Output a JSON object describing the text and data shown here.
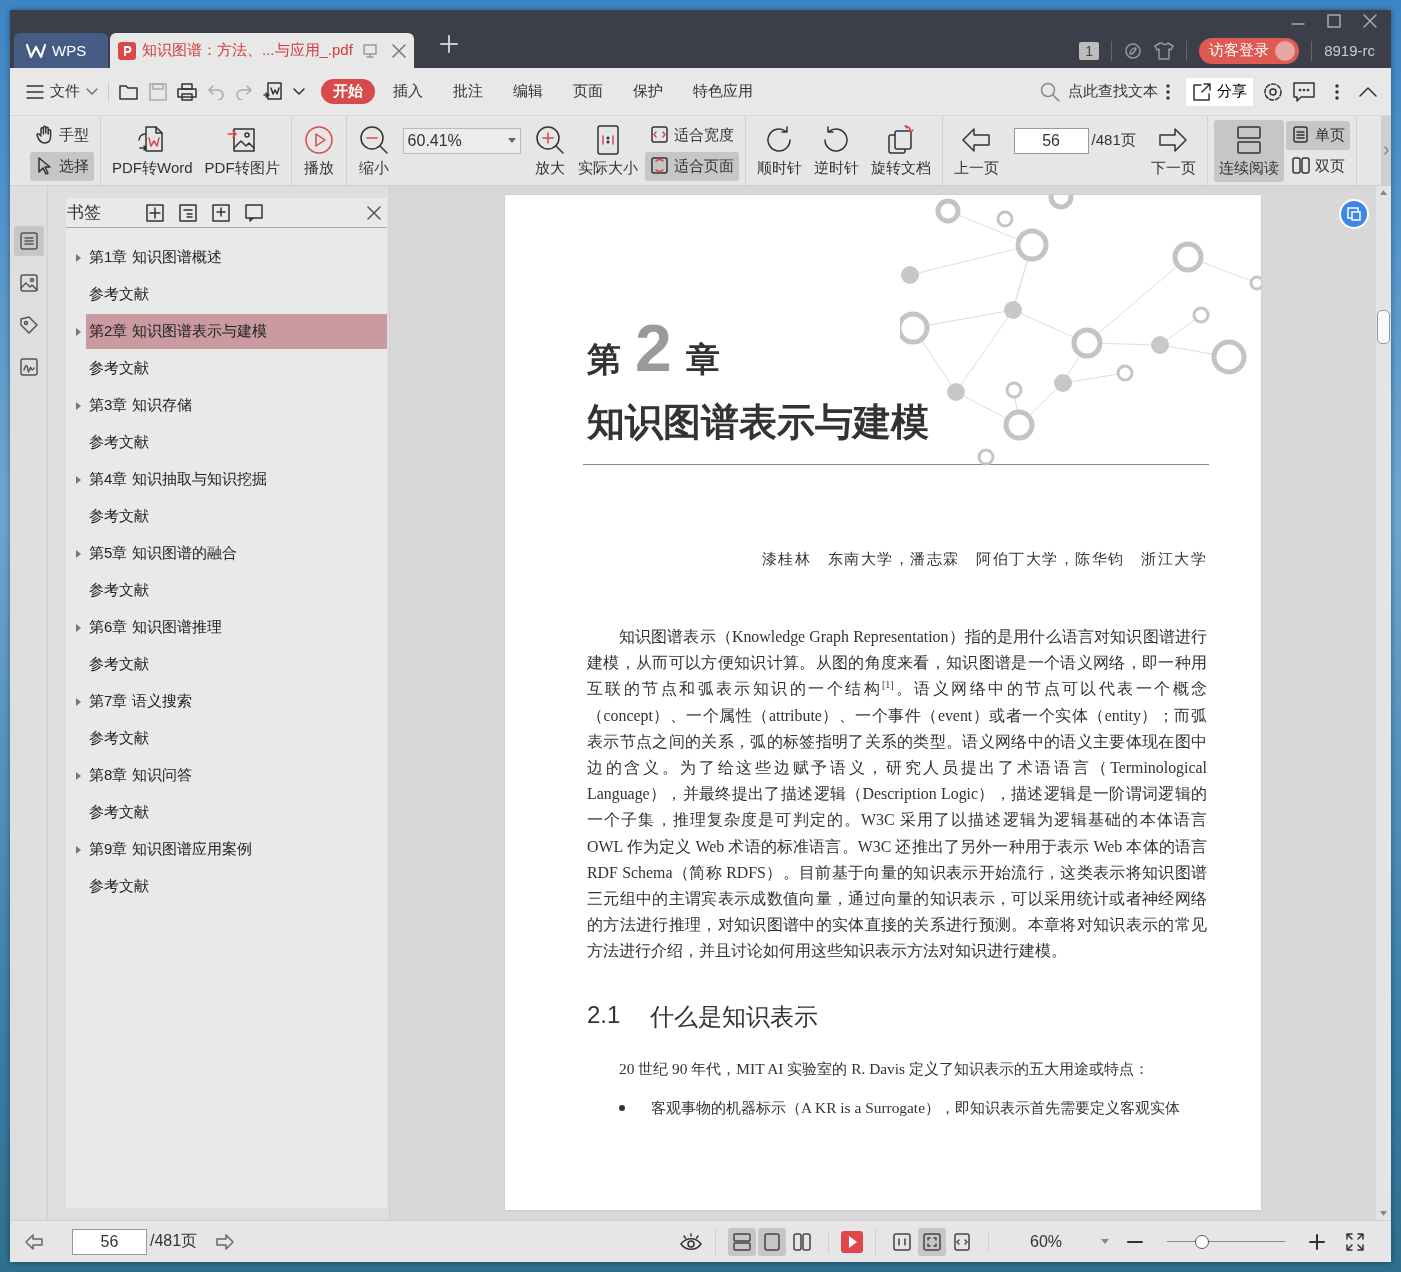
{
  "tabs": [
    {
      "kind": "home",
      "label": "WPS",
      "selected": false
    },
    {
      "kind": "document",
      "label": "知识图谱：方法、...与应用_.pdf",
      "selected": true
    }
  ],
  "account": {
    "badge": "1",
    "login": "访客登录",
    "user": "8919-rc"
  },
  "menu": {
    "file": "文件",
    "tabs": [
      {
        "label": "开始",
        "selected": true
      },
      {
        "label": "插入",
        "selected": false
      },
      {
        "label": "批注",
        "selected": false
      },
      {
        "label": "编辑",
        "selected": false
      },
      {
        "label": "页面",
        "selected": false
      },
      {
        "label": "保护",
        "selected": false
      },
      {
        "label": "特色应用",
        "selected": false
      }
    ],
    "search_placeholder": "点此查找文本",
    "share": "分享"
  },
  "toolbar": {
    "groups": [
      [
        {
          "kind": "pair",
          "items": [
            {
              "label": "手型",
              "selected": false
            },
            {
              "label": "选择",
              "selected": true
            }
          ]
        }
      ],
      [
        {
          "kind": "big",
          "label": "PDF转Word",
          "selected": false
        },
        {
          "kind": "big",
          "label": "PDF转图片",
          "selected": false
        }
      ],
      [
        {
          "kind": "big",
          "label": "播放",
          "selected": false
        }
      ],
      [
        {
          "kind": "big",
          "label": "缩小",
          "selected": false
        },
        {
          "kind": "zoom",
          "value": "60.41%"
        },
        {
          "kind": "big",
          "label": "放大",
          "selected": false
        },
        {
          "kind": "big",
          "label": "实际大小",
          "selected": false
        },
        {
          "kind": "pair",
          "items": [
            {
              "label": "适合宽度",
              "selected": false
            },
            {
              "label": "适合页面",
              "selected": true
            }
          ]
        }
      ],
      [
        {
          "kind": "big",
          "label": "顺时针",
          "selected": false
        },
        {
          "kind": "big",
          "label": "逆时针",
          "selected": false
        },
        {
          "kind": "big",
          "label": "旋转文档",
          "selected": false
        }
      ],
      [
        {
          "kind": "big",
          "label": "上一页",
          "selected": false
        },
        {
          "kind": "page",
          "value": "56",
          "total": "/481页"
        },
        {
          "kind": "big",
          "label": "下一页",
          "selected": false
        }
      ],
      [
        {
          "kind": "big",
          "label": "连续阅读",
          "selected": true
        },
        {
          "kind": "pair",
          "items": [
            {
              "label": "单页",
              "selected": true
            },
            {
              "label": "双页",
              "selected": false
            }
          ]
        }
      ]
    ]
  },
  "rail": [
    {
      "selected": true
    },
    {
      "selected": false
    },
    {
      "selected": false
    },
    {
      "selected": false
    }
  ],
  "sidebar": {
    "title": "书签",
    "items": [
      {
        "kind": "chapter",
        "label": "第1章 知识图谱概述",
        "expanded": false,
        "selected": false
      },
      {
        "kind": "reference",
        "label": "参考文献",
        "selected": false
      },
      {
        "kind": "chapter",
        "label": "第2章 知识图谱表示与建模",
        "expanded": false,
        "selected": true
      },
      {
        "kind": "reference",
        "label": "参考文献",
        "selected": false
      },
      {
        "kind": "chapter",
        "label": "第3章 知识存储",
        "expanded": false,
        "selected": false
      },
      {
        "kind": "reference",
        "label": "参考文献",
        "selected": false
      },
      {
        "kind": "chapter",
        "label": "第4章 知识抽取与知识挖掘",
        "expanded": false,
        "selected": false
      },
      {
        "kind": "reference",
        "label": "参考文献",
        "selected": false
      },
      {
        "kind": "chapter",
        "label": "第5章 知识图谱的融合",
        "expanded": false,
        "selected": false
      },
      {
        "kind": "reference",
        "label": "参考文献",
        "selected": false
      },
      {
        "kind": "chapter",
        "label": "第6章 知识图谱推理",
        "expanded": false,
        "selected": false
      },
      {
        "kind": "reference",
        "label": "参考文献",
        "selected": false
      },
      {
        "kind": "chapter",
        "label": "第7章 语义搜索",
        "expanded": false,
        "selected": false
      },
      {
        "kind": "reference",
        "label": "参考文献",
        "selected": false
      },
      {
        "kind": "chapter",
        "label": "第8章 知识问答",
        "expanded": false,
        "selected": false
      },
      {
        "kind": "reference",
        "label": "参考文献",
        "selected": false
      },
      {
        "kind": "chapter",
        "label": "第9章 知识图谱应用案例",
        "expanded": false,
        "selected": false
      },
      {
        "kind": "reference",
        "label": "参考文献",
        "selected": false
      }
    ]
  },
  "document": {
    "chapter_prefix": "第",
    "chapter_number": "2",
    "chapter_suffix": "章",
    "title": "知识图谱表示与建模",
    "authors": "漆桂林　东南大学，潘志霖　阿伯丁大学，陈华钧　浙江大学",
    "intro": "知识图谱表示（Knowledge Graph Representation）指的是用什么语言对知识图谱进行建模，从而可以方便知识计算。从图的角度来看，知识图谱是一个语义网络，即一种用互联的节点和弧表示知识的一个结构$^{[1]}$。语义网络中的节点可以代表一个概念（concept）、一个属性（attribute）、一个事件（event）或者一个实体（entity）；而弧表示节点之间的关系，弧的标签指明了关系的类型。语义网络中的语义主要体现在图中边的含义。为了给这些边赋予语义，研究人员提出了术语语言（Terminological Language），并最终提出了描述逻辑（Description Logic），描述逻辑是一阶谓词逻辑的一个子集，推理复杂度是可判定的。W3C 采用了以描述逻辑为逻辑基础的本体语言 OWL 作为定义 Web 术语的标准语言。W3C 还推出了另外一种用于表示 Web 本体的语言 RDF Schema（简称 RDFS）。目前基于向量的知识表示开始流行，这类表示将知识图谱三元组中的主谓宾表示成数值向量，通过向量的知识表示，可以采用统计或者神经网络的方法进行推理，对知识图谱中的实体直接的关系进行预测。本章将对知识表示的常见方法进行介绍，并且讨论如何用这些知识表示方法对知识进行建模。",
    "section_number": "2.1",
    "section_title": "什么是知识表示",
    "section_intro": "20 世纪 90 年代，MIT AI 实验室的 R. Davis 定义了知识表示的五大用途或特点：",
    "bullets": [
      "客观事物的机器标示（A KR is a Surrogate），即知识表示首先需要定义客观实体"
    ]
  },
  "statusbar": {
    "page": "56",
    "total": "/481页",
    "views": [
      {
        "selected": true
      },
      {
        "selected": true
      },
      {
        "selected": false
      }
    ],
    "fits": [
      {
        "selected": false
      },
      {
        "selected": true
      },
      {
        "selected": false
      }
    ],
    "zoom": "60%",
    "zoom_slider": {
      "level": 0.3
    }
  }
}
